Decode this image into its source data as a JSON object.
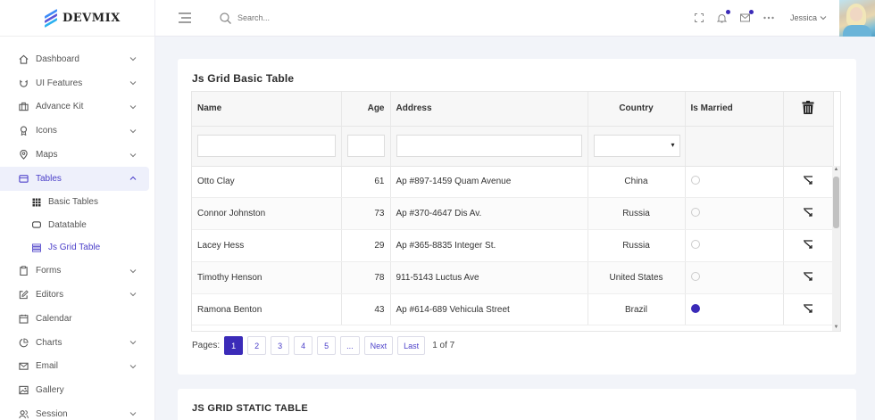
{
  "brand": {
    "name": "DEVMIX"
  },
  "header": {
    "search_placeholder": "Search...",
    "user_name": "Jessica"
  },
  "sidebar": {
    "items": [
      {
        "label": "Dashboard",
        "icon": "home-icon",
        "chevron": "down"
      },
      {
        "label": "UI Features",
        "icon": "magnet-icon",
        "chevron": "down"
      },
      {
        "label": "Advance Kit",
        "icon": "briefcase-icon",
        "chevron": "down"
      },
      {
        "label": "Icons",
        "icon": "award-icon",
        "chevron": "down"
      },
      {
        "label": "Maps",
        "icon": "map-pin-icon",
        "chevron": "down"
      },
      {
        "label": "Tables",
        "icon": "table-icon",
        "chevron": "up",
        "active": true
      },
      {
        "label": "Forms",
        "icon": "clipboard-icon",
        "chevron": "down"
      },
      {
        "label": "Editors",
        "icon": "edit-icon",
        "chevron": "down"
      },
      {
        "label": "Calendar",
        "icon": "calendar-icon"
      },
      {
        "label": "Charts",
        "icon": "pie-chart-icon",
        "chevron": "down"
      },
      {
        "label": "Email",
        "icon": "mail-icon",
        "chevron": "down"
      },
      {
        "label": "Gallery",
        "icon": "image-icon"
      },
      {
        "label": "Session",
        "icon": "users-icon",
        "chevron": "down"
      }
    ],
    "sub_items": [
      {
        "label": "Basic Tables",
        "icon": "grid-icon"
      },
      {
        "label": "Datatable",
        "icon": "tablet-icon"
      },
      {
        "label": "Js Grid Table",
        "icon": "list-icon",
        "active": true
      }
    ]
  },
  "grid_card": {
    "title": "Js Grid Basic Table",
    "columns": [
      "Name",
      "Age",
      "Address",
      "Country",
      "Is Married"
    ],
    "rows": [
      {
        "name": "Otto Clay",
        "age": "61",
        "address": "Ap #897-1459 Quam Avenue",
        "country": "China",
        "married": false
      },
      {
        "name": "Connor Johnston",
        "age": "73",
        "address": "Ap #370-4647 Dis Av.",
        "country": "Russia",
        "married": false
      },
      {
        "name": "Lacey Hess",
        "age": "29",
        "address": "Ap #365-8835 Integer St.",
        "country": "Russia",
        "married": false
      },
      {
        "name": "Timothy Henson",
        "age": "78",
        "address": "911-5143 Luctus Ave",
        "country": "United States",
        "married": false
      },
      {
        "name": "Ramona Benton",
        "age": "43",
        "address": "Ap #614-689 Vehicula Street",
        "country": "Brazil",
        "married": true
      }
    ],
    "pager": {
      "label": "Pages:",
      "pages": [
        "1",
        "2",
        "3",
        "4",
        "5",
        "..."
      ],
      "current": "1",
      "next": "Next",
      "last": "Last",
      "info": "1 of 7"
    }
  },
  "static_card": {
    "title": "JS GRID STATIC TABLE"
  },
  "colors": {
    "accent": "#3b2bb8",
    "active_bg": "#eef0fb",
    "page_bg": "#f2f4f9"
  }
}
